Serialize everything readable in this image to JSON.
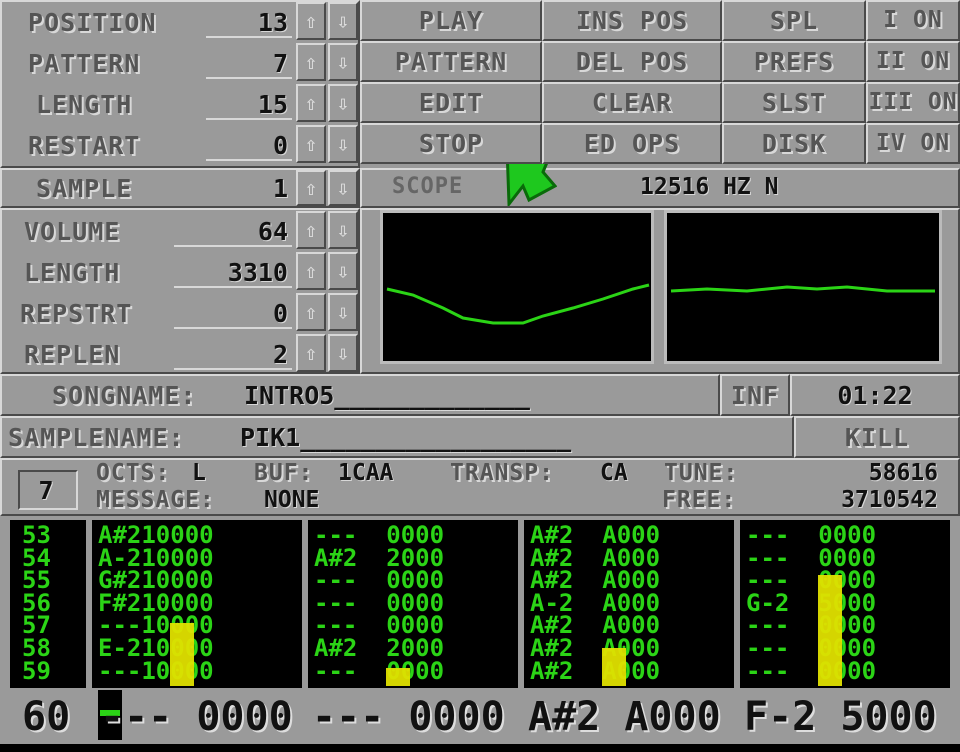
{
  "song_rows": [
    {
      "label": "POSITION",
      "value": "13"
    },
    {
      "label": "PATTERN",
      "value": "7"
    },
    {
      "label": "LENGTH",
      "value": "15"
    },
    {
      "label": "RESTART",
      "value": "0"
    }
  ],
  "buttons_col1": [
    "PLAY",
    "PATTERN",
    "EDIT",
    "STOP"
  ],
  "buttons_col2": [
    "INS POS",
    "DEL POS",
    "CLEAR",
    "ED OPS"
  ],
  "buttons_col3": [
    "SPL",
    "PREFS",
    "SLST",
    "DISK"
  ],
  "channels": [
    "I ON",
    "II ON",
    "III ON",
    "IV ON"
  ],
  "sample": {
    "label": "SAMPLE",
    "value": "1"
  },
  "sample_rows": [
    {
      "label": "VOLUME",
      "value": "64"
    },
    {
      "label": "LENGTH",
      "value": "3310"
    },
    {
      "label": "REPSTRT",
      "value": "0"
    },
    {
      "label": "REPLEN",
      "value": "2"
    }
  ],
  "scope": {
    "label": "SCOPE",
    "freq": "12516 HZ N"
  },
  "songname": {
    "label": "SONGNAME:",
    "value": "INTRO5_____________"
  },
  "inf_label": "INF",
  "time": "01:22",
  "samplename": {
    "label": "SAMPLENAME:",
    "value": "PIK1__________________"
  },
  "kill_label": "KILL",
  "info": {
    "box_value": "7",
    "octs_label": "OCTS:",
    "octs_value": "L",
    "buf_label": "BUF:",
    "buf_value": "1CAA",
    "transp_label": "TRANSP:",
    "transp_value": "CA",
    "tune_label": "TUNE:",
    "tune_value": "58616",
    "message_label": "MESSAGE:",
    "message_value": "NONE",
    "free_label": "FREE:",
    "free_value": "3710542"
  },
  "pattern": {
    "row_numbers": [
      "53",
      "54",
      "55",
      "56",
      "57",
      "58",
      "59"
    ],
    "channels": [
      [
        "A#210000",
        "A-210000",
        "G#210000",
        "F#210000",
        "---10000",
        "E-210000",
        "---10000"
      ],
      [
        "---  0000",
        "A#2  2000",
        "---  0000",
        "---  0000",
        "---  0000",
        "A#2  2000",
        "---  0000"
      ],
      [
        "A#2  A000",
        "A#2  A000",
        "A#2  A000",
        "A-2  A000",
        "A#2  A000",
        "A#2  A000",
        "A#2  A000"
      ],
      [
        "---  0000",
        "---  0000",
        "---  0000",
        "G-2  5000",
        "---  0000",
        "---  0000",
        "---  0000"
      ]
    ],
    "vu_levels": [
      0.42,
      0.12,
      0.25,
      0.74
    ],
    "current": {
      "row": "60",
      "cells": [
        "--- 0000",
        "--- 0000",
        "A#2 A000",
        "F-2 5000"
      ]
    }
  }
}
